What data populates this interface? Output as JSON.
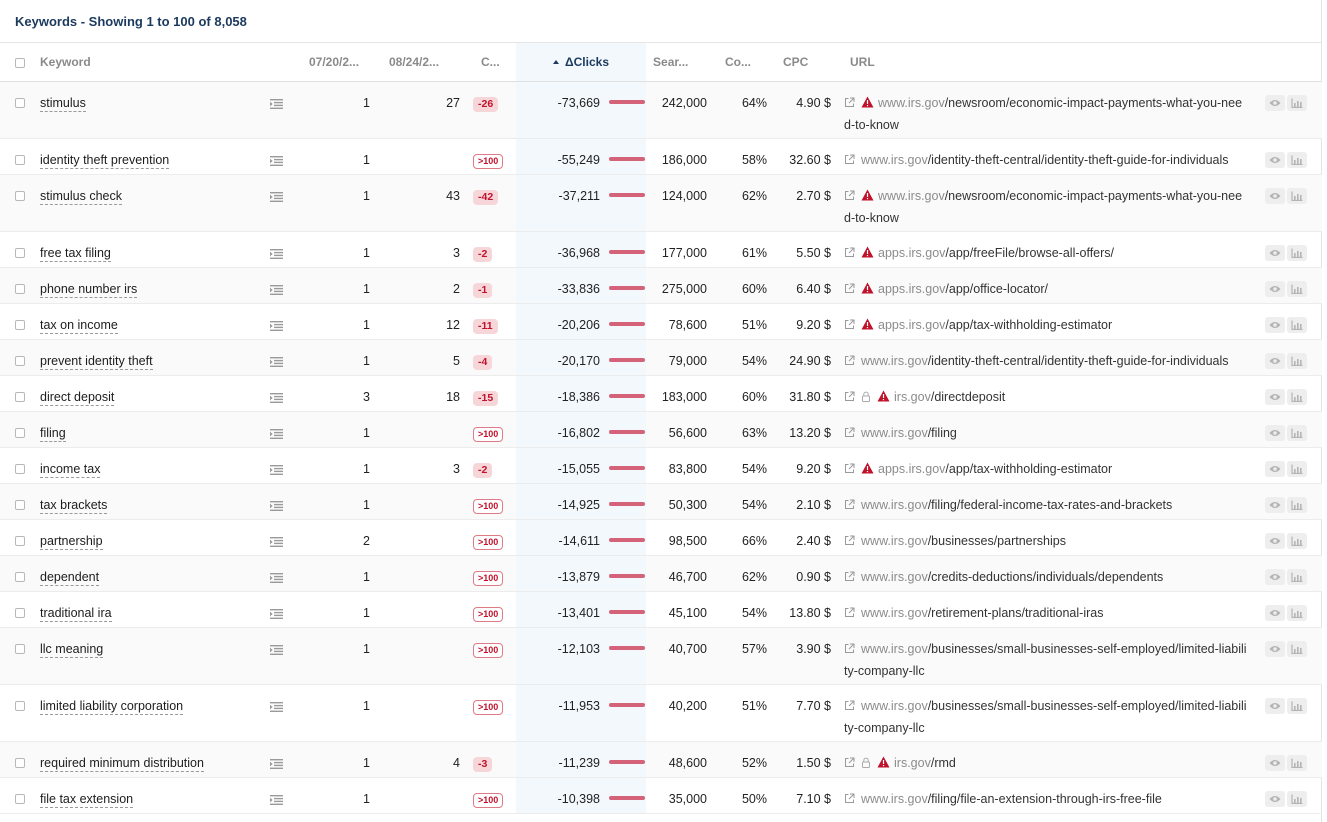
{
  "header": {
    "title": "Keywords - Showing 1 to 100 of 8,058"
  },
  "columns": {
    "keyword": "Keyword",
    "date1": "07/20/2...",
    "date2": "08/24/2...",
    "change": "C...",
    "delta_clicks": "ΔClicks",
    "search_volume": "Sear...",
    "competition": "Co...",
    "cpc": "CPC",
    "url": "URL"
  },
  "colors": {
    "bar": "#d4637a",
    "warning": "#c0122b",
    "title": "#1b3a5e"
  },
  "rows": [
    {
      "keyword": "stimulus",
      "pos1": "1",
      "pos2": "27",
      "change": "-26",
      "change_type": "neg",
      "delta": "-73,669",
      "volume": "242,000",
      "comp": "64%",
      "cpc": "4.90 $",
      "warn": true,
      "lock": false,
      "domain": "www.irs.gov",
      "path": "/newsroom/economic-impact-payments-what-you-need-to-know",
      "tall": true
    },
    {
      "keyword": "identity theft prevention",
      "pos1": "1",
      "pos2": "",
      "change": ">100",
      "change_type": "out",
      "delta": "-55,249",
      "volume": "186,000",
      "comp": "58%",
      "cpc": "32.60 $",
      "warn": false,
      "lock": false,
      "domain": "www.irs.gov",
      "path": "/identity-theft-central/identity-theft-guide-for-individuals",
      "tall": false
    },
    {
      "keyword": "stimulus check",
      "pos1": "1",
      "pos2": "43",
      "change": "-42",
      "change_type": "neg",
      "delta": "-37,211",
      "volume": "124,000",
      "comp": "62%",
      "cpc": "2.70 $",
      "warn": true,
      "lock": false,
      "domain": "www.irs.gov",
      "path": "/newsroom/economic-impact-payments-what-you-need-to-know",
      "tall": true
    },
    {
      "keyword": "free tax filing",
      "pos1": "1",
      "pos2": "3",
      "change": "-2",
      "change_type": "neg",
      "delta": "-36,968",
      "volume": "177,000",
      "comp": "61%",
      "cpc": "5.50 $",
      "warn": true,
      "lock": false,
      "domain": "apps.irs.gov",
      "path": "/app/freeFile/browse-all-offers/",
      "tall": false
    },
    {
      "keyword": "phone number irs",
      "pos1": "1",
      "pos2": "2",
      "change": "-1",
      "change_type": "neg",
      "delta": "-33,836",
      "volume": "275,000",
      "comp": "60%",
      "cpc": "6.40 $",
      "warn": true,
      "lock": false,
      "domain": "apps.irs.gov",
      "path": "/app/office-locator/",
      "tall": false
    },
    {
      "keyword": "tax on income",
      "pos1": "1",
      "pos2": "12",
      "change": "-11",
      "change_type": "neg",
      "delta": "-20,206",
      "volume": "78,600",
      "comp": "51%",
      "cpc": "9.20 $",
      "warn": true,
      "lock": false,
      "domain": "apps.irs.gov",
      "path": "/app/tax-withholding-estimator",
      "tall": false
    },
    {
      "keyword": "prevent identity theft",
      "pos1": "1",
      "pos2": "5",
      "change": "-4",
      "change_type": "neg",
      "delta": "-20,170",
      "volume": "79,000",
      "comp": "54%",
      "cpc": "24.90 $",
      "warn": false,
      "lock": false,
      "domain": "www.irs.gov",
      "path": "/identity-theft-central/identity-theft-guide-for-individuals",
      "tall": false
    },
    {
      "keyword": "direct deposit",
      "pos1": "3",
      "pos2": "18",
      "change": "-15",
      "change_type": "neg",
      "delta": "-18,386",
      "volume": "183,000",
      "comp": "60%",
      "cpc": "31.80 $",
      "warn": true,
      "lock": true,
      "domain": "irs.gov",
      "path": "/directdeposit",
      "tall": false
    },
    {
      "keyword": "filing",
      "pos1": "1",
      "pos2": "",
      "change": ">100",
      "change_type": "out",
      "delta": "-16,802",
      "volume": "56,600",
      "comp": "63%",
      "cpc": "13.20 $",
      "warn": false,
      "lock": false,
      "domain": "www.irs.gov",
      "path": "/filing",
      "tall": false
    },
    {
      "keyword": "income tax",
      "pos1": "1",
      "pos2": "3",
      "change": "-2",
      "change_type": "neg",
      "delta": "-15,055",
      "volume": "83,800",
      "comp": "54%",
      "cpc": "9.20 $",
      "warn": true,
      "lock": false,
      "domain": "apps.irs.gov",
      "path": "/app/tax-withholding-estimator",
      "tall": false
    },
    {
      "keyword": "tax brackets",
      "pos1": "1",
      "pos2": "",
      "change": ">100",
      "change_type": "out",
      "delta": "-14,925",
      "volume": "50,300",
      "comp": "54%",
      "cpc": "2.10 $",
      "warn": false,
      "lock": false,
      "domain": "www.irs.gov",
      "path": "/filing/federal-income-tax-rates-and-brackets",
      "tall": false
    },
    {
      "keyword": "partnership",
      "pos1": "2",
      "pos2": "",
      "change": ">100",
      "change_type": "out",
      "delta": "-14,611",
      "volume": "98,500",
      "comp": "66%",
      "cpc": "2.40 $",
      "warn": false,
      "lock": false,
      "domain": "www.irs.gov",
      "path": "/businesses/partnerships",
      "tall": false
    },
    {
      "keyword": "dependent",
      "pos1": "1",
      "pos2": "",
      "change": ">100",
      "change_type": "out",
      "delta": "-13,879",
      "volume": "46,700",
      "comp": "62%",
      "cpc": "0.90 $",
      "warn": false,
      "lock": false,
      "domain": "www.irs.gov",
      "path": "/credits-deductions/individuals/dependents",
      "tall": false
    },
    {
      "keyword": "traditional ira",
      "pos1": "1",
      "pos2": "",
      "change": ">100",
      "change_type": "out",
      "delta": "-13,401",
      "volume": "45,100",
      "comp": "54%",
      "cpc": "13.80 $",
      "warn": false,
      "lock": false,
      "domain": "www.irs.gov",
      "path": "/retirement-plans/traditional-iras",
      "tall": false
    },
    {
      "keyword": "llc meaning",
      "pos1": "1",
      "pos2": "",
      "change": ">100",
      "change_type": "out",
      "delta": "-12,103",
      "volume": "40,700",
      "comp": "57%",
      "cpc": "3.90 $",
      "warn": false,
      "lock": false,
      "domain": "www.irs.gov",
      "path": "/businesses/small-businesses-self-employed/limited-liability-company-llc",
      "tall": true
    },
    {
      "keyword": "limited liability corporation",
      "pos1": "1",
      "pos2": "",
      "change": ">100",
      "change_type": "out",
      "delta": "-11,953",
      "volume": "40,200",
      "comp": "51%",
      "cpc": "7.70 $",
      "warn": false,
      "lock": false,
      "domain": "www.irs.gov",
      "path": "/businesses/small-businesses-self-employed/limited-liability-company-llc",
      "tall": true
    },
    {
      "keyword": "required minimum distribution",
      "pos1": "1",
      "pos2": "4",
      "change": "-3",
      "change_type": "neg",
      "delta": "-11,239",
      "volume": "48,600",
      "comp": "52%",
      "cpc": "1.50 $",
      "warn": true,
      "lock": true,
      "domain": "irs.gov",
      "path": "/rmd",
      "tall": false
    },
    {
      "keyword": "file tax extension",
      "pos1": "1",
      "pos2": "",
      "change": ">100",
      "change_type": "out",
      "delta": "-10,398",
      "volume": "35,000",
      "comp": "50%",
      "cpc": "7.10 $",
      "warn": false,
      "lock": false,
      "domain": "www.irs.gov",
      "path": "/filing/file-an-extension-through-irs-free-file",
      "tall": false
    }
  ]
}
